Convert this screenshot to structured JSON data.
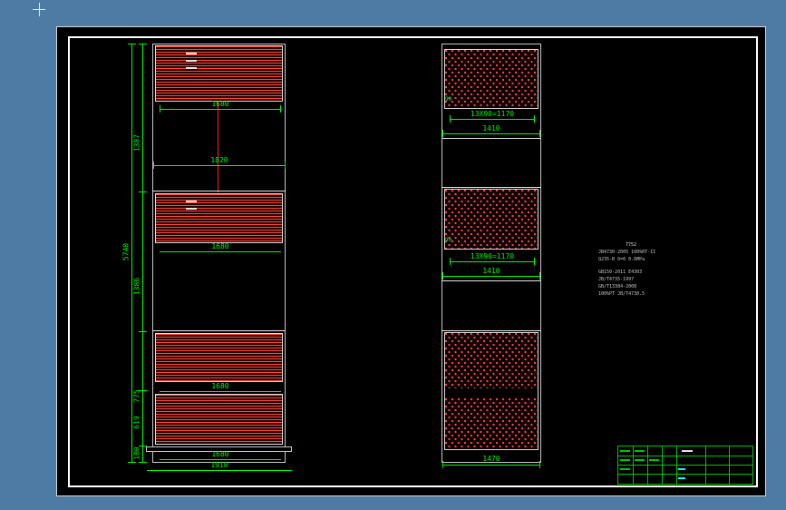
{
  "colors": {
    "background": "#4d7ba4",
    "paper": "#000000",
    "border_white": "#ffffff",
    "dimension_green": "#00ff00",
    "hatch_red": "#ff3a2e",
    "title_table_green": "#00c800",
    "accent_cyan": "#00ffff"
  },
  "left_view": {
    "dims": {
      "top_width": "1680",
      "mid_width": "1820",
      "sec2_width": "1680",
      "sec3_width": "1680",
      "sec4_width": "1680",
      "base_width": "1910",
      "seg1_height": "1387",
      "seg2_height": "1386",
      "overall_height": "5740",
      "seg3_height": "775",
      "seg4_height": "619",
      "base_height": "100"
    }
  },
  "right_view": {
    "dims": {
      "edge_top": "90",
      "pitch_top": "13X90=1170",
      "width_top": "1410",
      "edge_mid": "90",
      "pitch_mid": "13X90=1170",
      "width_mid": "1410",
      "base_width": "1470"
    }
  },
  "notes": {
    "lines": [
      "7752",
      "JB4730-2005 100%RT-II",
      "Q235-B  δ=6  0.6MPa",
      "GB150-2011  E4303",
      "JB/T4735-1997",
      "GB/T13384-2008",
      "100%PT JB/T4730.5"
    ]
  }
}
